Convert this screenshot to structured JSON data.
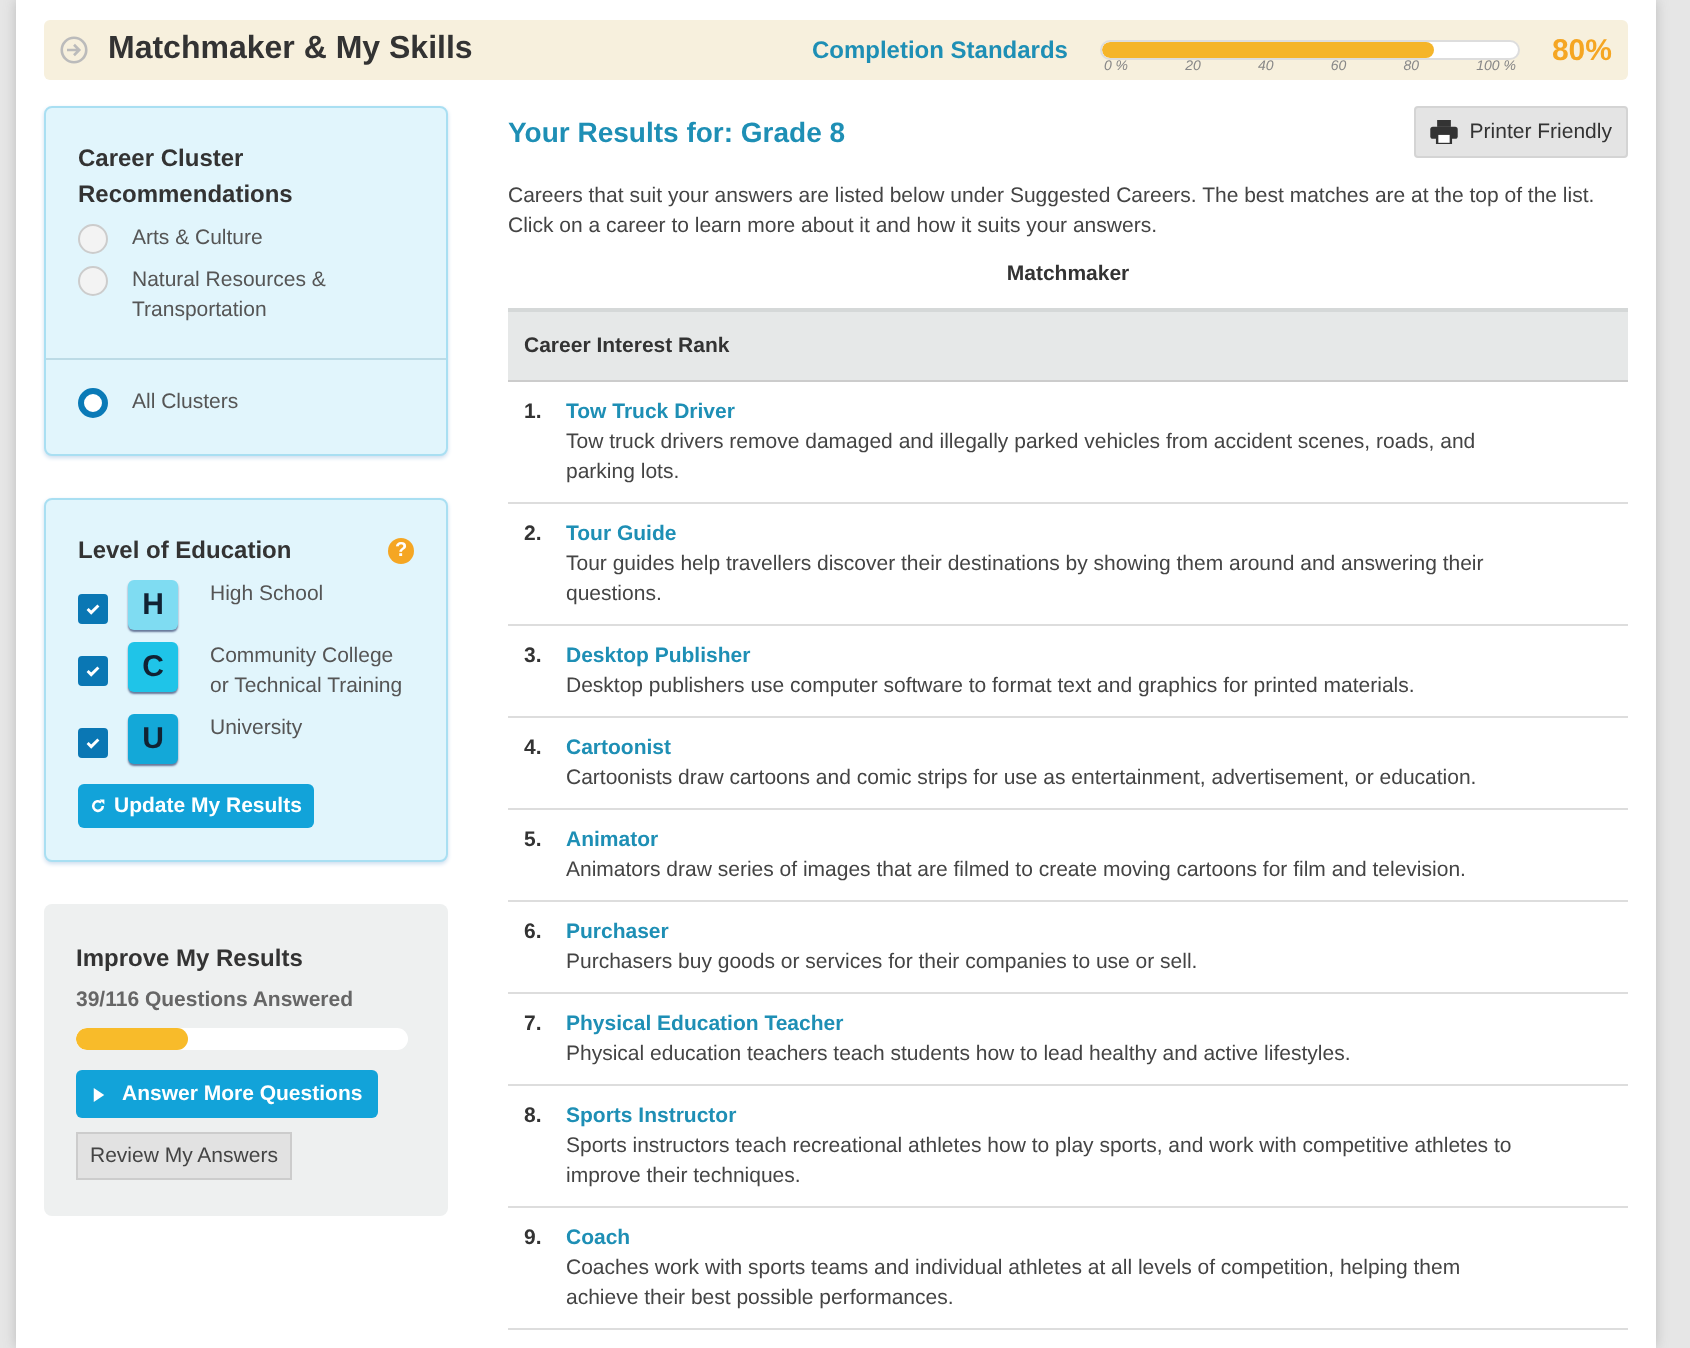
{
  "header": {
    "title": "Matchmaker & My Skills",
    "completion_label": "Completion Standards",
    "level": 0.8,
    "ticks": [
      "0 %",
      "20",
      "40",
      "60",
      "80",
      "100 %"
    ],
    "percent": "80%"
  },
  "clusters": {
    "title": "Career Cluster Recommendations",
    "options": [
      {
        "label": "Arts & Culture",
        "selected": false
      },
      {
        "label": "Natural Resources & Transportation",
        "selected": false
      }
    ],
    "all": {
      "label": "All Clusters",
      "selected": true
    }
  },
  "education": {
    "title": "Level of Education",
    "help": "?",
    "levels": [
      {
        "letter": "H",
        "label": "High School",
        "checked": true,
        "color": "#7fdcf2"
      },
      {
        "letter": "C",
        "label": "Community College or Technical Training",
        "checked": true,
        "color": "#1fc4e8"
      },
      {
        "letter": "U",
        "label": "University",
        "checked": true,
        "color": "#13a8d8"
      }
    ],
    "button": "Update My Results"
  },
  "improve": {
    "title": "Improve My Results",
    "count": "39/116 Questions Answered",
    "level": 0.34,
    "answer_button": "Answer More Questions",
    "review_button": "Review My Answers"
  },
  "results": {
    "title": "Your Results for: Grade 8",
    "print_button": "Printer Friendly",
    "intro": "Careers that suit your answers are listed below under Suggested Careers. The best matches are at the top of the list. Click on a career to learn more about it and how it suits your answers.",
    "table_caption": "Matchmaker",
    "column": "Career Interest Rank",
    "careers": [
      {
        "rank": "1.",
        "name": "Tow Truck Driver",
        "desc": "Tow truck drivers remove damaged and illegally parked vehicles from accident scenes, roads, and parking lots."
      },
      {
        "rank": "2.",
        "name": "Tour Guide",
        "desc": "Tour guides help travellers discover their destinations by showing them around and answering their questions."
      },
      {
        "rank": "3.",
        "name": "Desktop Publisher",
        "desc": "Desktop publishers use computer software to format text and graphics for printed materials."
      },
      {
        "rank": "4.",
        "name": "Cartoonist",
        "desc": "Cartoonists draw cartoons and comic strips for use as entertainment, advertisement, or education."
      },
      {
        "rank": "5.",
        "name": "Animator",
        "desc": "Animators draw series of images that are filmed to create moving cartoons for film and television."
      },
      {
        "rank": "6.",
        "name": "Purchaser",
        "desc": "Purchasers buy goods or services for their companies to use or sell."
      },
      {
        "rank": "7.",
        "name": "Physical Education Teacher",
        "desc": "Physical education teachers teach students how to lead healthy and active lifestyles."
      },
      {
        "rank": "8.",
        "name": "Sports Instructor",
        "desc": "Sports instructors teach recreational athletes how to play sports, and work with competitive athletes to improve their techniques."
      },
      {
        "rank": "9.",
        "name": "Coach",
        "desc": "Coaches work with sports teams and individual athletes at all levels of competition, helping them achieve their best possible performances."
      }
    ]
  }
}
